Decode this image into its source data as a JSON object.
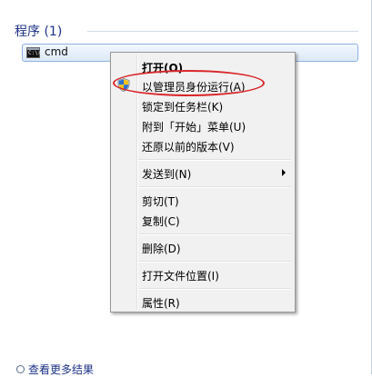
{
  "programs_section": {
    "header": "程序 (1)",
    "items": [
      {
        "label": "cmd",
        "icon": "cmd-icon",
        "icon_text": "C:\\>_"
      }
    ]
  },
  "context_menu": {
    "items": [
      {
        "label": "打开(O)",
        "bold": true
      },
      {
        "label": "以管理员身份运行(A)",
        "icon": "uac-shield-icon",
        "highlighted": true
      },
      {
        "label": "锁定到任务栏(K)"
      },
      {
        "label": "附到「开始」菜单(U)"
      },
      {
        "label": "还原以前的版本(V)"
      },
      {
        "label": "发送到(N)",
        "has_submenu": true
      },
      {
        "label": "剪切(T)"
      },
      {
        "label": "复制(C)"
      },
      {
        "label": "删除(D)"
      },
      {
        "label": "打开文件位置(I)"
      },
      {
        "label": "属性(R)"
      }
    ]
  },
  "footer": {
    "see_more_label": "查看更多结果",
    "icon": "search-icon"
  },
  "colors": {
    "header_text": "#1e3287",
    "annotation": "#d9262a",
    "menu_bg": "#f1f1f1"
  }
}
